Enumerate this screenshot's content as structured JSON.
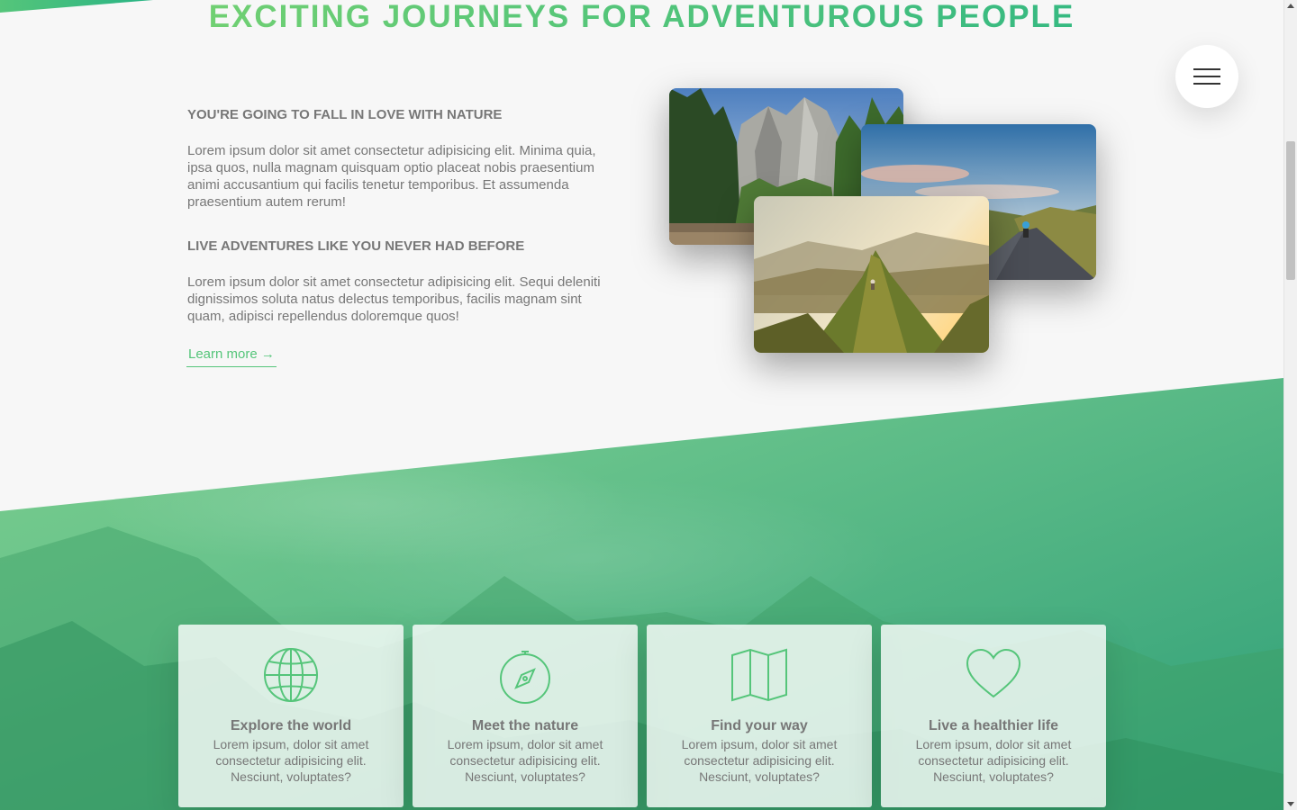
{
  "header": {
    "title": "EXCITING JOURNEYS FOR ADVENTUROUS PEOPLE"
  },
  "navigation": {
    "icon": "hamburger-menu-icon"
  },
  "about": {
    "heading_1": "YOU'RE GOING TO FALL IN LOVE WITH NATURE",
    "paragraph_1": "Lorem ipsum dolor sit amet consectetur adipisicing elit. Minima quia, ipsa quos, nulla magnam quisquam optio placeat nobis praesentium animi accusantium qui facilis tenetur temporibus. Et assumenda praesentium autem rerum!",
    "heading_2": "LIVE ADVENTURES LIKE YOU NEVER HAD BEFORE",
    "paragraph_2": "Lorem ipsum dolor sit amet consectetur adipisicing elit. Sequi deleniti dignissimos soluta natus delectus temporibus, facilis magnam sint quam, adipisci repellendus doloremque quos!",
    "link_label": "Learn more →"
  },
  "photos": [
    {
      "subject": "forest-cliffs-photo"
    },
    {
      "subject": "cyclist-road-photo"
    },
    {
      "subject": "mountain-ridge-hiker-photo"
    }
  ],
  "features": [
    {
      "icon": "globe-icon",
      "title": "Explore the world",
      "text": "Lorem ipsum, dolor sit amet consectetur adipisicing elit. Nesciunt, voluptates?"
    },
    {
      "icon": "compass-icon",
      "title": "Meet the nature",
      "text": "Lorem ipsum, dolor sit amet consectetur adipisicing elit. Nesciunt, voluptates?"
    },
    {
      "icon": "map-icon",
      "title": "Find your way",
      "text": "Lorem ipsum, dolor sit amet consectetur adipisicing elit. Nesciunt, voluptates?"
    },
    {
      "icon": "heart-icon",
      "title": "Live a healthier life",
      "text": "Lorem ipsum, dolor sit amet consectetur adipisicing elit. Nesciunt, voluptates?"
    }
  ],
  "colors": {
    "primary_light": "#7ed56f",
    "primary": "#55c57a",
    "primary_dark": "#28b485",
    "text": "#777777",
    "background": "#f7f7f7"
  }
}
